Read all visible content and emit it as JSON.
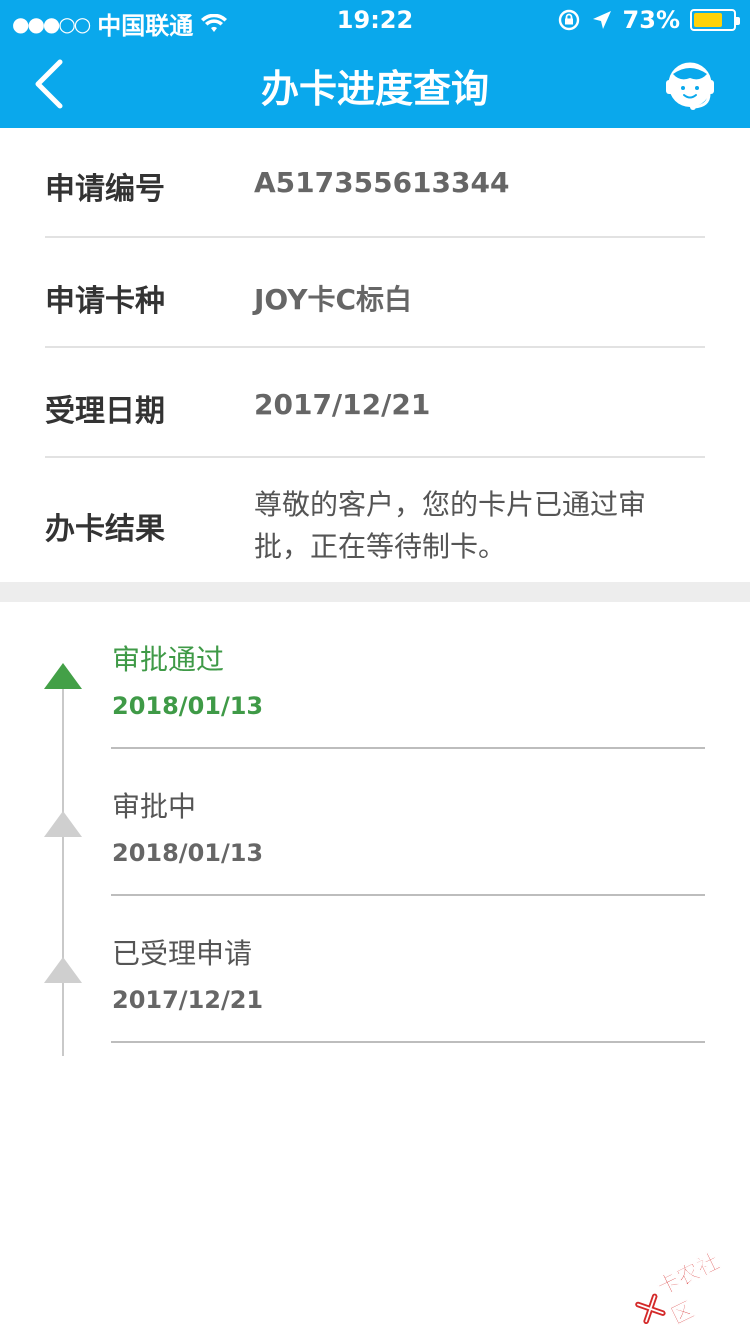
{
  "status_bar": {
    "signal": "●●●○○",
    "carrier": "中国联通",
    "time": "19:22",
    "battery_percent": "73%",
    "battery_level": 0.73
  },
  "nav": {
    "title": "办卡进度查询",
    "back_icon": "chevron-left-icon",
    "service_icon": "customer-service-icon"
  },
  "info_rows": [
    {
      "label": "申请编号",
      "value": "A517355613344"
    },
    {
      "label": "申请卡种",
      "value": "JOY卡C标白"
    },
    {
      "label": "受理日期",
      "value": "2017/12/21"
    },
    {
      "label": "办卡结果",
      "value": "尊敬的客户，您的卡片已通过审批，正在等待制卡。"
    }
  ],
  "timeline": [
    {
      "title": "审批通过",
      "date": "2018/01/13",
      "state": "active"
    },
    {
      "title": "审批中",
      "date": "2018/01/13",
      "state": "done"
    },
    {
      "title": "已受理申请",
      "date": "2017/12/21",
      "state": "done"
    }
  ],
  "watermark": {
    "text": "卡农社区"
  },
  "colors": {
    "header": "#0aa8ec",
    "active_green": "#3f9a47",
    "inactive_gray": "#cfcfcf",
    "battery_yellow": "#ffd20a"
  }
}
